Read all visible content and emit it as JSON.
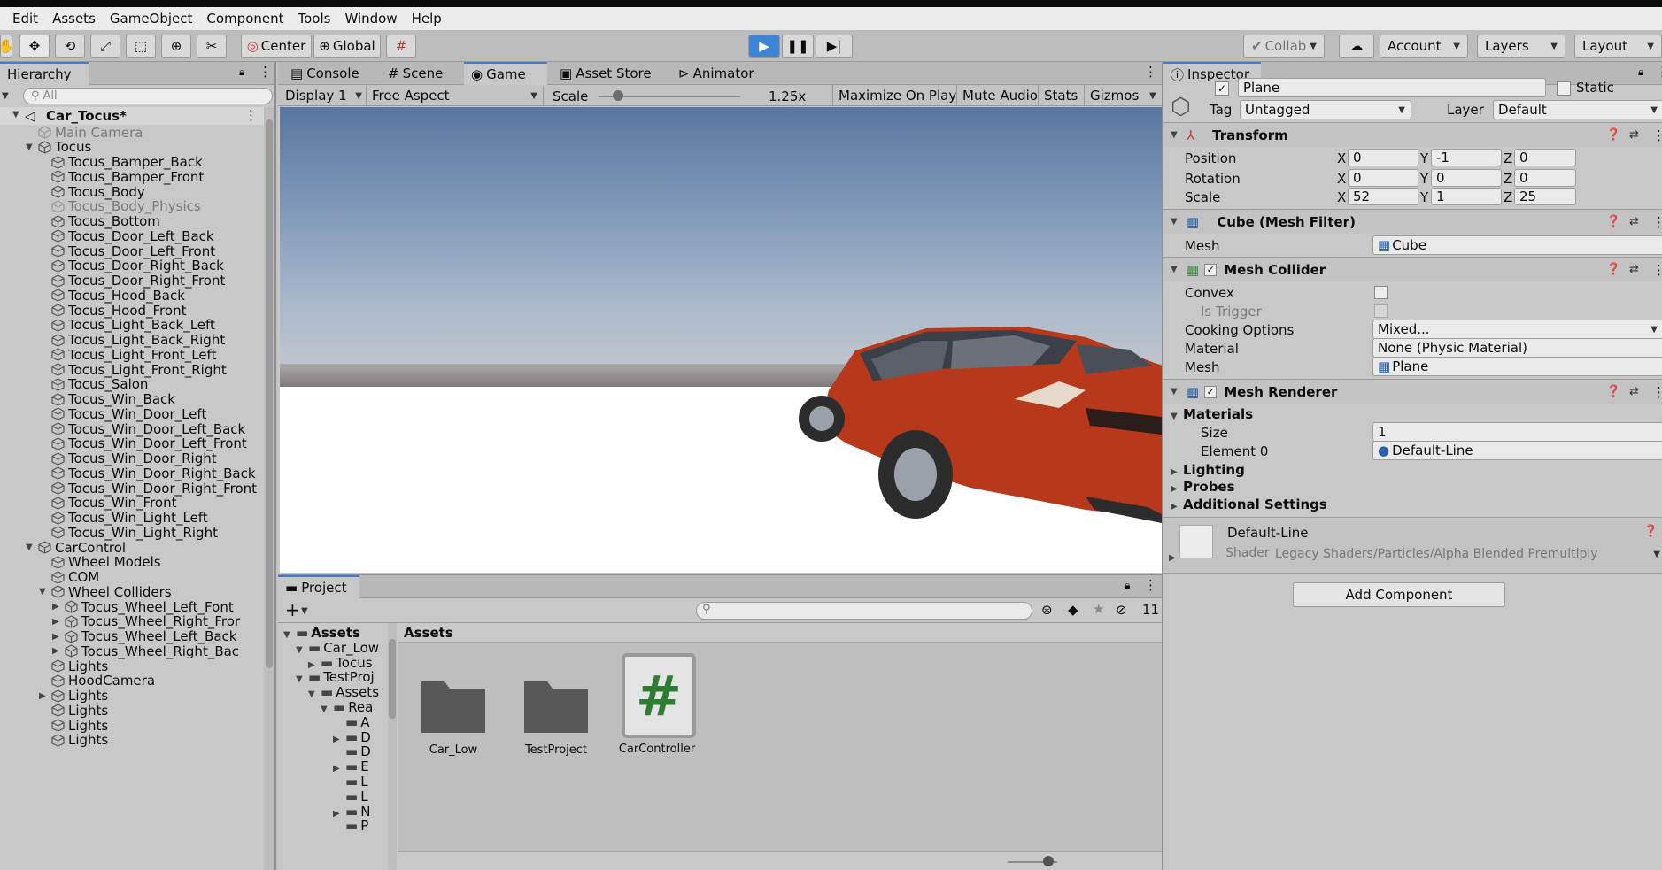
{
  "menu": [
    "Edit",
    "Assets",
    "GameObject",
    "Component",
    "Tools",
    "Window",
    "Help"
  ],
  "toolbar": {
    "center": "Center",
    "global": "Global",
    "collab": "Collab",
    "account": "Account",
    "layers": "Layers",
    "layout": "Layout"
  },
  "hierarchy": {
    "tab": "Hierarchy",
    "search_placeholder": "All",
    "scene": "Car_Tocus*",
    "items": [
      {
        "label": "Main Camera",
        "depth": 1,
        "disabled": true
      },
      {
        "label": "Tocus",
        "depth": 1,
        "expanded": true
      },
      {
        "label": "Tocus_Bamper_Back",
        "depth": 2
      },
      {
        "label": "Tocus_Bamper_Front",
        "depth": 2
      },
      {
        "label": "Tocus_Body",
        "depth": 2
      },
      {
        "label": "Tocus_Body_Physics",
        "depth": 2,
        "disabled": true
      },
      {
        "label": "Tocus_Bottom",
        "depth": 2
      },
      {
        "label": "Tocus_Door_Left_Back",
        "depth": 2
      },
      {
        "label": "Tocus_Door_Left_Front",
        "depth": 2
      },
      {
        "label": "Tocus_Door_Right_Back",
        "depth": 2
      },
      {
        "label": "Tocus_Door_Right_Front",
        "depth": 2
      },
      {
        "label": "Tocus_Hood_Back",
        "depth": 2
      },
      {
        "label": "Tocus_Hood_Front",
        "depth": 2
      },
      {
        "label": "Tocus_Light_Back_Left",
        "depth": 2
      },
      {
        "label": "Tocus_Light_Back_Right",
        "depth": 2
      },
      {
        "label": "Tocus_Light_Front_Left",
        "depth": 2
      },
      {
        "label": "Tocus_Light_Front_Right",
        "depth": 2
      },
      {
        "label": "Tocus_Salon",
        "depth": 2
      },
      {
        "label": "Tocus_Win_Back",
        "depth": 2
      },
      {
        "label": "Tocus_Win_Door_Left",
        "depth": 2
      },
      {
        "label": "Tocus_Win_Door_Left_Back",
        "depth": 2
      },
      {
        "label": "Tocus_Win_Door_Left_Front",
        "depth": 2
      },
      {
        "label": "Tocus_Win_Door_Right",
        "depth": 2
      },
      {
        "label": "Tocus_Win_Door_Right_Back",
        "depth": 2
      },
      {
        "label": "Tocus_Win_Door_Right_Front",
        "depth": 2
      },
      {
        "label": "Tocus_Win_Front",
        "depth": 2
      },
      {
        "label": "Tocus_Win_Light_Left",
        "depth": 2
      },
      {
        "label": "Tocus_Win_Light_Right",
        "depth": 2
      },
      {
        "label": "CarControl",
        "depth": 1,
        "expanded": true
      },
      {
        "label": "Wheel Models",
        "depth": 2
      },
      {
        "label": "COM",
        "depth": 2
      },
      {
        "label": "Wheel Colliders",
        "depth": 2,
        "expanded": true
      },
      {
        "label": "Tocus_Wheel_Left_Font",
        "depth": 3,
        "collapsed": true
      },
      {
        "label": "Tocus_Wheel_Right_Fror",
        "depth": 3,
        "collapsed": true
      },
      {
        "label": "Tocus_Wheel_Left_Back",
        "depth": 3,
        "collapsed": true
      },
      {
        "label": "Tocus_Wheel_Right_Bac",
        "depth": 3,
        "collapsed": true
      },
      {
        "label": "Lights",
        "depth": 2
      },
      {
        "label": "HoodCamera",
        "depth": 2
      },
      {
        "label": "Lights",
        "depth": 2,
        "collapsed": true
      },
      {
        "label": "Lights",
        "depth": 2
      },
      {
        "label": "Lights",
        "depth": 2
      },
      {
        "label": "Lights",
        "depth": 2
      }
    ]
  },
  "center_tabs": [
    "Console",
    "Scene",
    "Game",
    "Asset Store",
    "Animator"
  ],
  "game_bar": {
    "display": "Display 1",
    "aspect": "Free Aspect",
    "scale_label": "Scale",
    "scale_value": "1.25x",
    "maximize": "Maximize On Play",
    "mute": "Mute Audio",
    "stats": "Stats",
    "gizmos": "Gizmos"
  },
  "project": {
    "tab": "Project",
    "hidden_count": "11",
    "tree": [
      {
        "label": "Assets",
        "bold": true,
        "depth": 0
      },
      {
        "label": "Car_Low",
        "depth": 1
      },
      {
        "label": "Tocus",
        "depth": 2
      },
      {
        "label": "TestProj",
        "depth": 1
      },
      {
        "label": "Assets",
        "depth": 2
      },
      {
        "label": "Rea",
        "depth": 3
      },
      {
        "label": "A",
        "depth": 4
      },
      {
        "label": "D",
        "depth": 4
      },
      {
        "label": "D",
        "depth": 4
      },
      {
        "label": "E",
        "depth": 4
      },
      {
        "label": "L",
        "depth": 4
      },
      {
        "label": "L",
        "depth": 4
      },
      {
        "label": "N",
        "depth": 4
      },
      {
        "label": "P",
        "depth": 4
      }
    ],
    "breadcrumb": "Assets",
    "assets": [
      {
        "label": "Car_Low",
        "icon": "folder-icon"
      },
      {
        "label": "TestProject",
        "icon": "folder-icon"
      },
      {
        "label": "CarController",
        "icon": "script-icon"
      }
    ]
  },
  "inspector": {
    "tab": "Inspector",
    "object_name": "Plane",
    "static_label": "Static",
    "tag_label": "Tag",
    "tag_value": "Untagged",
    "layer_label": "Layer",
    "layer_value": "Default",
    "transform": {
      "title": "Transform",
      "position_label": "Position",
      "position": [
        "0",
        "-1",
        "0"
      ],
      "rotation_label": "Rotation",
      "rotation": [
        "0",
        "0",
        "0"
      ],
      "scale_label": "Scale",
      "scale": [
        "52",
        "1",
        "25"
      ]
    },
    "mesh_filter": {
      "title": "Cube (Mesh Filter)",
      "mesh_label": "Mesh",
      "mesh_value": "Cube"
    },
    "mesh_collider": {
      "title": "Mesh Collider",
      "convex": "Convex",
      "is_trigger": "Is Trigger",
      "cooking_label": "Cooking Options",
      "cooking_value": "Mixed...",
      "material_label": "Material",
      "material_value": "None (Physic Material)",
      "mesh_label": "Mesh",
      "mesh_value": "Plane"
    },
    "mesh_renderer": {
      "title": "Mesh Renderer",
      "materials": "Materials",
      "size_label": "Size",
      "size_value": "1",
      "element_label": "Element 0",
      "element_value": "Default-Line",
      "lighting": "Lighting",
      "probes": "Probes",
      "additional": "Additional Settings"
    },
    "material": {
      "name": "Default-Line",
      "shader_label": "Shader",
      "shader_value": "Legacy Shaders/Particles/Alpha Blended Premultiply"
    },
    "add_component": "Add Component"
  },
  "axis_labels": {
    "x": "X",
    "y": "Y",
    "z": "Z"
  },
  "colors": {
    "accent": "#3d84d6",
    "car": "#b8381c",
    "sky_top": "#5a77a0",
    "ground": "#ffffff"
  }
}
